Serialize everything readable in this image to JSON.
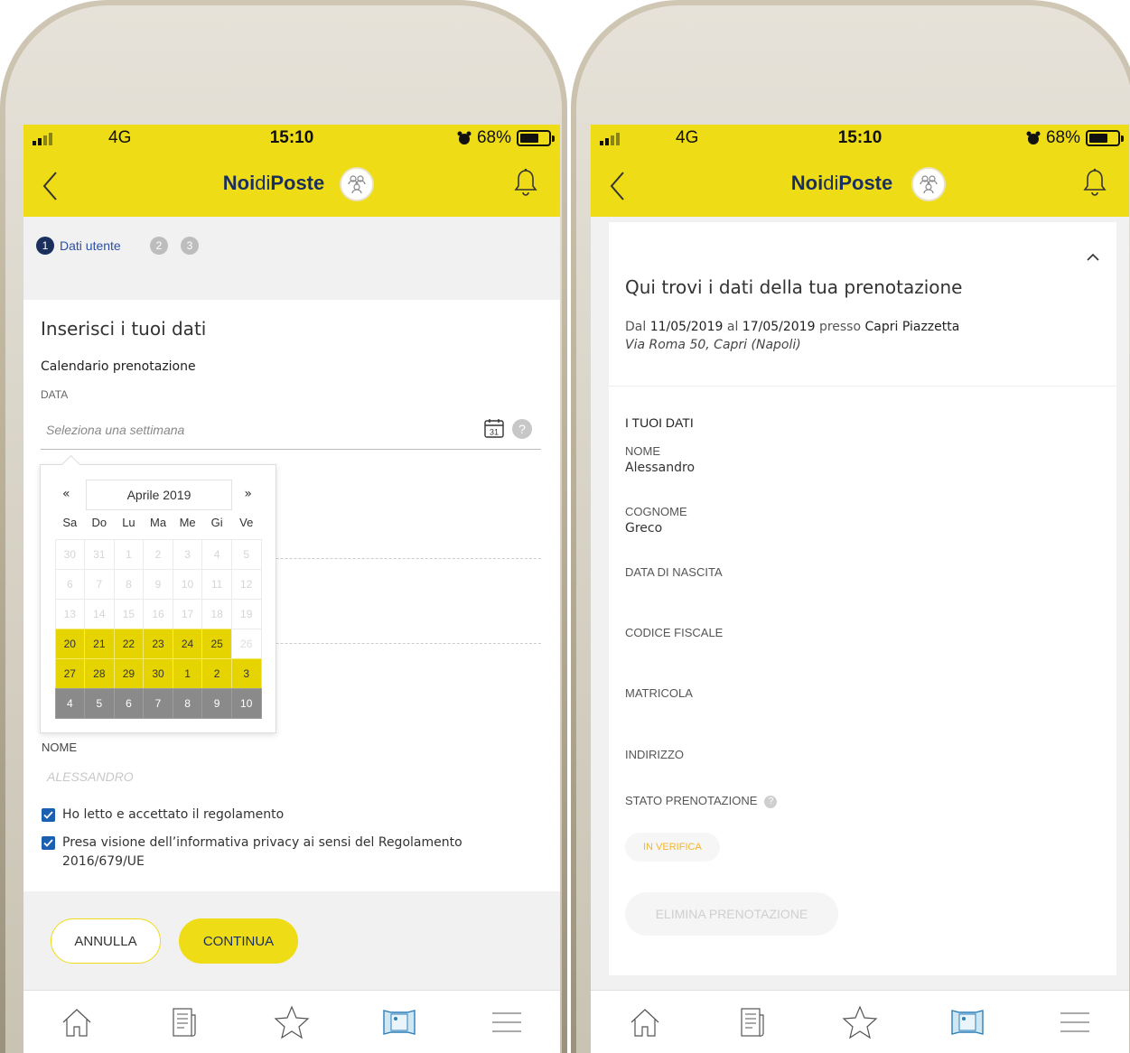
{
  "status": {
    "network": "4G",
    "time": "15:10",
    "battery": "68%"
  },
  "brand": {
    "noi": "Noi",
    "di": "di",
    "poste": "Poste"
  },
  "left": {
    "steps": [
      {
        "num": "1",
        "label": "Dati utente"
      },
      {
        "num": "2"
      },
      {
        "num": "3"
      }
    ],
    "title": "Inserisci i tuoi dati",
    "calendar_section": "Calendario prenotazione",
    "date_label": "DATA",
    "date_placeholder": "Seleziona una settimana",
    "calendar_icon_day": "31",
    "help": "?",
    "calendar": {
      "prev": "«",
      "next": "»",
      "month": "Aprile 2019",
      "weekdays": [
        "Sa",
        "Do",
        "Lu",
        "Ma",
        "Me",
        "Gi",
        "Ve"
      ],
      "rows": [
        [
          {
            "d": "30",
            "s": "past"
          },
          {
            "d": "31",
            "s": "past"
          },
          {
            "d": "1",
            "s": "past"
          },
          {
            "d": "2",
            "s": "past"
          },
          {
            "d": "3",
            "s": "past"
          },
          {
            "d": "4",
            "s": "past"
          },
          {
            "d": "5",
            "s": "past"
          }
        ],
        [
          {
            "d": "6",
            "s": "past"
          },
          {
            "d": "7",
            "s": "past"
          },
          {
            "d": "8",
            "s": "past"
          },
          {
            "d": "9",
            "s": "past"
          },
          {
            "d": "10",
            "s": "past"
          },
          {
            "d": "11",
            "s": "past"
          },
          {
            "d": "12",
            "s": "past"
          }
        ],
        [
          {
            "d": "13",
            "s": "past"
          },
          {
            "d": "14",
            "s": "past"
          },
          {
            "d": "15",
            "s": "past"
          },
          {
            "d": "16",
            "s": "past"
          },
          {
            "d": "17",
            "s": "past"
          },
          {
            "d": "18",
            "s": "past"
          },
          {
            "d": "19",
            "s": "past"
          }
        ],
        [
          {
            "d": "20",
            "s": "week"
          },
          {
            "d": "21",
            "s": "week"
          },
          {
            "d": "22",
            "s": "week"
          },
          {
            "d": "23",
            "s": "week"
          },
          {
            "d": "24",
            "s": "week"
          },
          {
            "d": "25",
            "s": "week"
          },
          {
            "d": "26",
            "s": "dim"
          }
        ],
        [
          {
            "d": "27",
            "s": "week"
          },
          {
            "d": "28",
            "s": "week"
          },
          {
            "d": "29",
            "s": "week"
          },
          {
            "d": "30",
            "s": "week"
          },
          {
            "d": "1",
            "s": "week"
          },
          {
            "d": "2",
            "s": "week"
          },
          {
            "d": "3",
            "s": "week"
          }
        ],
        [
          {
            "d": "4",
            "s": "dis"
          },
          {
            "d": "5",
            "s": "dis"
          },
          {
            "d": "6",
            "s": "dis"
          },
          {
            "d": "7",
            "s": "dis"
          },
          {
            "d": "8",
            "s": "dis"
          },
          {
            "d": "9",
            "s": "dis"
          },
          {
            "d": "10",
            "s": "dis"
          }
        ]
      ]
    },
    "nome_label": "NOME",
    "nome_value": "ALESSANDRO",
    "check1": "Ho letto e accettato il regolamento",
    "check2": "Presa visione dell’informativa privacy ai sensi del Regolamento 2016/679/UE",
    "cancel": "ANNULLA",
    "continue": "CONTINUA"
  },
  "right": {
    "title": "Qui trovi i dati della tua prenotazione",
    "dal_word": "Dal",
    "date_from": "11/05/2019",
    "al_word": "al",
    "date_to": "17/05/2019",
    "presso_word": "presso",
    "place": "Capri Piazzetta",
    "address": "Via Roma 50, Capri (Napoli)",
    "section": "I TUOI DATI",
    "fields": [
      {
        "label": "NOME",
        "value": "Alessandro"
      },
      {
        "label": "COGNOME",
        "value": "Greco"
      },
      {
        "label": "DATA DI NASCITA",
        "value": ""
      },
      {
        "label": "CODICE FISCALE",
        "value": ""
      },
      {
        "label": "MATRICOLA",
        "value": ""
      },
      {
        "label": "INDIRIZZO",
        "value": ""
      }
    ],
    "stato_label": "STATO PRENOTAZIONE",
    "stato_badge": "IN VERIFICA",
    "delete": "ELIMINA PRENOTAZIONE"
  },
  "icons": [
    "chevron-left-icon",
    "bell-icon",
    "avatar-icon",
    "home-icon",
    "news-icon",
    "star-icon",
    "map-icon",
    "menu-icon"
  ],
  "colors": {
    "brand_yellow": "#eedc16",
    "brand_blue": "#1b2f5e",
    "selected_week": "#e6d400",
    "badge_text": "#f2b630"
  }
}
